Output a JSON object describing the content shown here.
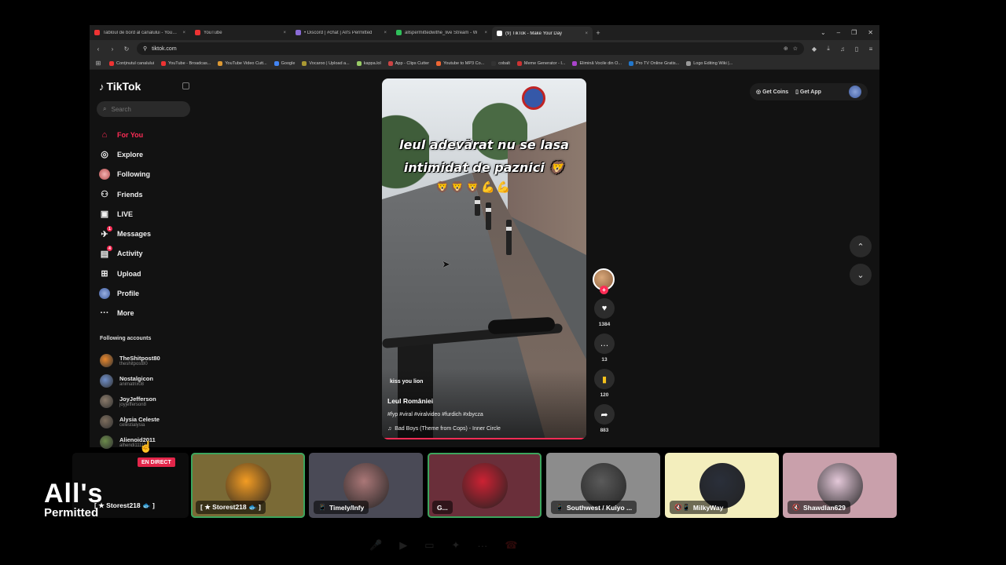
{
  "browser": {
    "tabs": [
      {
        "label": "Tabloul de bord al canalului - YouTube",
        "color": "#e33"
      },
      {
        "label": "YouTube",
        "color": "#e33"
      },
      {
        "label": "• Discord | #chat | All's Permitted",
        "color": "#8a6bd6"
      },
      {
        "label": "allspermittedwithe_live Stream - W",
        "color": "#2fbf5a"
      },
      {
        "label": "(9) TikTok - Make Your Day",
        "color": "#ffffff",
        "active": true
      }
    ],
    "url": "tiktok.com",
    "bookmarks": [
      {
        "label": "Conținutul canalului",
        "color": "#e33"
      },
      {
        "label": "YouTube - Broadcas...",
        "color": "#e33"
      },
      {
        "label": "YouTube Video Cutt...",
        "color": "#d93"
      },
      {
        "label": "Google",
        "color": "#4285f4"
      },
      {
        "label": "Vocaroo | Upload a...",
        "color": "#a93"
      },
      {
        "label": "kappa.lol",
        "color": "#9c6"
      },
      {
        "label": "App - Clips Cutter",
        "color": "#c44"
      },
      {
        "label": "Youtube to MP3 Co...",
        "color": "#e63"
      },
      {
        "label": "cobalt",
        "color": "#333"
      },
      {
        "label": "Meme Generator - I...",
        "color": "#c33"
      },
      {
        "label": "Elimină Vocile din O...",
        "color": "#a4c"
      },
      {
        "label": "Pro TV Online Gratis...",
        "color": "#27c"
      },
      {
        "label": "Logo Editing Wiki |...",
        "color": "#999"
      }
    ]
  },
  "tiktok": {
    "logo": "TikTok",
    "search_placeholder": "Search",
    "nav": [
      {
        "label": "For You",
        "icon": "home-icon",
        "glyph": "⌂",
        "active": true
      },
      {
        "label": "Explore",
        "icon": "compass-icon",
        "glyph": "◎"
      },
      {
        "label": "Following",
        "icon": "following-avatar-icon",
        "glyph": "●"
      },
      {
        "label": "Friends",
        "icon": "friends-icon",
        "glyph": "⚇"
      },
      {
        "label": "LIVE",
        "icon": "live-tv-icon",
        "glyph": "▣"
      },
      {
        "label": "Messages",
        "icon": "messages-icon",
        "glyph": "✈",
        "badge": "1"
      },
      {
        "label": "Activity",
        "icon": "activity-icon",
        "glyph": "▤",
        "badge": "4"
      },
      {
        "label": "Upload",
        "icon": "upload-icon",
        "glyph": "⊞"
      },
      {
        "label": "Profile",
        "icon": "profile-avatar-icon",
        "glyph": "●"
      },
      {
        "label": "More",
        "icon": "more-icon",
        "glyph": "···"
      }
    ],
    "following_header": "Following accounts",
    "following": [
      {
        "name": "TheShitpost80",
        "handle": "theshitpost80",
        "color": "#e8872c"
      },
      {
        "name": "Nostalgicon",
        "handle": "animatrix08",
        "color": "#6f8fc9"
      },
      {
        "name": "JoyJefferson",
        "handle": "joyjefferson8",
        "color": "#8a7a6a"
      },
      {
        "name": "Alysia Celeste",
        "handle": "celestialysia",
        "color": "#7d6d5d"
      },
      {
        "name": "Alienoid2011",
        "handle": "alhendi11111",
        "color": "#6b8a4a"
      }
    ],
    "top": {
      "get_coins": "Get Coins",
      "get_app": "Get App"
    },
    "video": {
      "overlay_line1": "leul adevărat nu se lasa",
      "overlay_line2": "intimidat de paznici 🦁",
      "overlay_emoji": "🦁🦁🦁💪💪",
      "sticker_text": "kiss you lion",
      "author": "Leul României",
      "tags": "#fyp #viral #viralvideo #furdich #xbycza",
      "music": "Bad Boys (Theme from Cops) - Inner Circle"
    },
    "actions": {
      "likes": "1384",
      "comments": "13",
      "saves": "120",
      "shares": "883"
    }
  },
  "call": {
    "live_badge": "EN DIRECT",
    "screen_label": "[ ★ Storest218 🐟 ]",
    "tiles": [
      {
        "label": "[ ★ Storest218 🐟 ]",
        "bg": "#7a6a36",
        "pfp": "#f39c23",
        "speaking": true,
        "device": ""
      },
      {
        "label": "Timely/Infy",
        "bg": "#4a4a56",
        "pfp": "#a77",
        "speaking": false,
        "device": "📱"
      },
      {
        "label": "G...",
        "bg": "#6a2f3a",
        "pfp": "#c23",
        "speaking": true,
        "device": ""
      },
      {
        "label": "Southwest / Kuiyo ...",
        "bg": "#8c8c8c",
        "pfp": "#5a5a5a",
        "speaking": false,
        "device": "📱"
      },
      {
        "label": "MilkyWay",
        "bg": "#f3eebd",
        "pfp": "#2a2f3a",
        "speaking": false,
        "device": "🔇📱"
      },
      {
        "label": "Shawdlan629",
        "bg": "#c9a0ab",
        "pfp": "#e4c8d9",
        "speaking": false,
        "device": "🔇"
      }
    ]
  },
  "brand": {
    "main": "All's",
    "sub": "Permitted"
  }
}
